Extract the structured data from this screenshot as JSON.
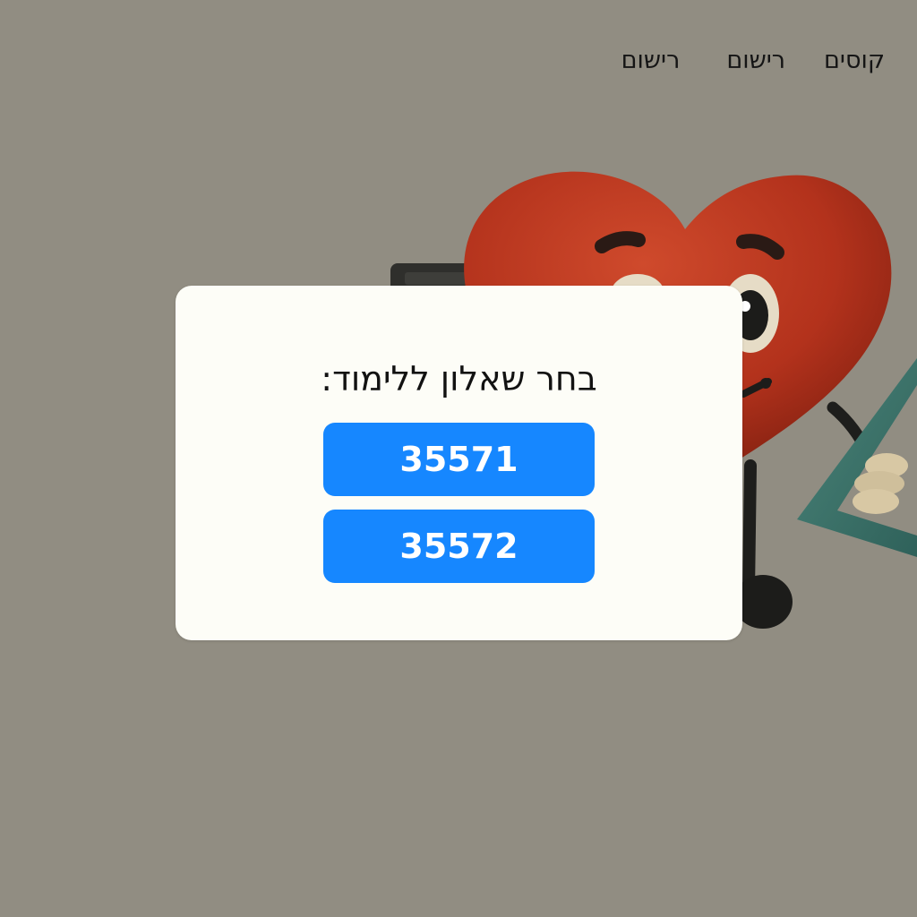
{
  "nav": {
    "items": [
      {
        "label": "קוסים"
      },
      {
        "label": "רישום"
      },
      {
        "label": "רישום"
      }
    ]
  },
  "dialog": {
    "title": "בחר שאלון ללימוד:",
    "options": [
      {
        "label": "35571"
      },
      {
        "label": "35572"
      }
    ]
  },
  "illustration": {
    "subject": "heart-mascot-with-calculator-and-ruler",
    "colors": {
      "heart": "#b3321c",
      "accent_button": "#1687ff",
      "background": "#918d82"
    }
  }
}
